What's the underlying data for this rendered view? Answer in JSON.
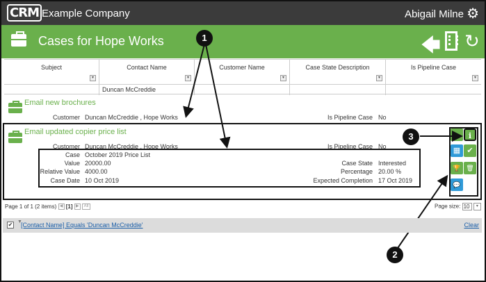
{
  "app": {
    "logo": "CRM",
    "company": "Example Company",
    "user": "Abigail Milne",
    "settings_icon": "gear-icon"
  },
  "header": {
    "title": "Cases for Hope Works",
    "icons": [
      "back-arrow-icon",
      "company-building-icon",
      "refresh-icon"
    ]
  },
  "grid": {
    "columns": [
      {
        "label": "Subject"
      },
      {
        "label": "Contact Name"
      },
      {
        "label": "Customer Name"
      },
      {
        "label": "Case State Description"
      },
      {
        "label": "Is Pipeline Case"
      }
    ],
    "filters": [
      "",
      "Duncan McCreddie",
      "",
      "",
      ""
    ],
    "filter_button_glyph": "▾"
  },
  "rows": [
    {
      "title": "Email new brochures",
      "customer_label": "Customer",
      "customer": "Duncan McCreddie , Hope Works",
      "pipeline_label": "Is Pipeline Case",
      "pipeline": "No"
    },
    {
      "title": "Email updated copier price list",
      "customer_label": "Customer",
      "customer": "Duncan McCreddie , Hope Works",
      "pipeline_label": "Is Pipeline Case",
      "pipeline": "No",
      "details_left": [
        {
          "label": "Case",
          "value": "October 2019 Price List"
        },
        {
          "label": "Value",
          "value": "20000.00"
        },
        {
          "label": "Relative Value",
          "value": "4000.00"
        },
        {
          "label": "Case Date",
          "value": "10 Oct 2019"
        }
      ],
      "details_right": [
        {
          "label": "Case State",
          "value": "Interested"
        },
        {
          "label": "Percentage",
          "value": "20.00 %"
        },
        {
          "label": "Expected Completion",
          "value": "17 Oct 2019"
        }
      ]
    }
  ],
  "actions": [
    {
      "name": "open-icon",
      "glyph": "▶",
      "color": "#6ab04c"
    },
    {
      "name": "info-icon",
      "glyph": "ℹ",
      "color": "#6ab04c"
    },
    {
      "name": "calendar-icon",
      "glyph": "▦",
      "color": "#2f9ad8"
    },
    {
      "name": "complete-check-icon",
      "glyph": "✔",
      "color": "#6ab04c"
    },
    {
      "name": "trophy-icon",
      "glyph": "🏆",
      "color": "#6ab04c"
    },
    {
      "name": "delete-trash-icon",
      "glyph": "🗑",
      "color": "#6ab04c"
    },
    {
      "name": "comments-icon",
      "glyph": "💬",
      "color": "#2f9ad8"
    }
  ],
  "callouts": [
    "1",
    "2",
    "3"
  ],
  "pager": {
    "text": "Page 1 of 1 (2 items)",
    "current": "[1]",
    "prev_glyph": "◀",
    "next_glyph": "▶",
    "all_label": "All",
    "size_label": "Page size:",
    "size_value": "10",
    "size_drop_glyph": "▾"
  },
  "filter_bar": {
    "checked_glyph": "✔",
    "funnel_glyph": "▼",
    "text": "[Contact Name] Equals 'Duncan McCreddie'",
    "clear": "Clear"
  },
  "colors": {
    "topbar": "#3b3b3b",
    "accent_green": "#6ab04c",
    "accent_blue": "#2f9ad8",
    "link": "#1a5ea8"
  }
}
